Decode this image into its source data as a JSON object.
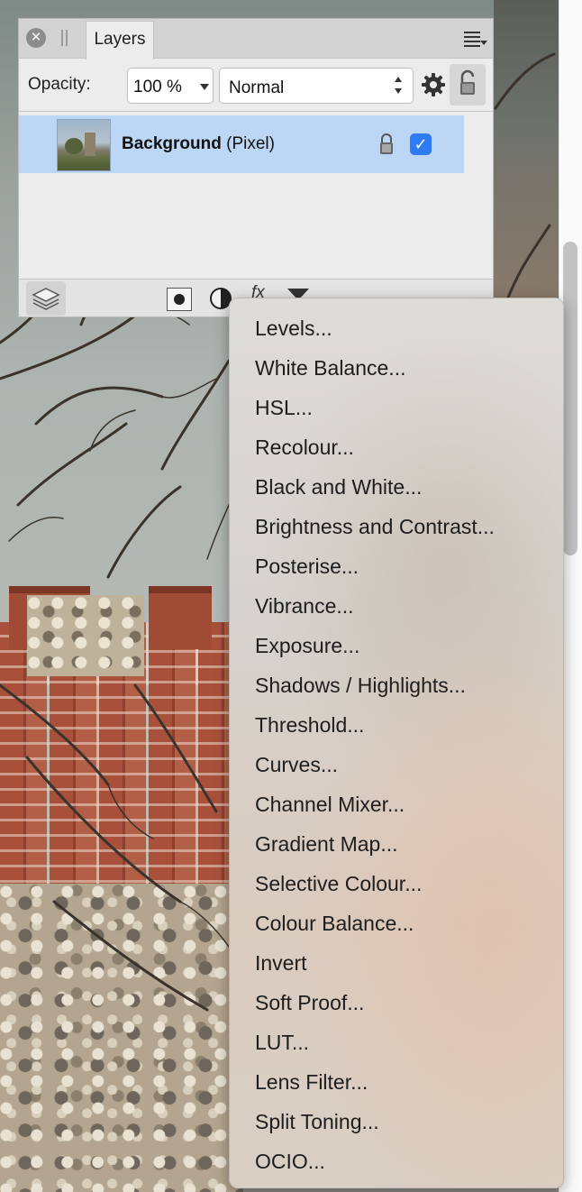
{
  "panel": {
    "tab_label": "Layers",
    "opacity_label": "Opacity:",
    "opacity_value": "100 %",
    "blend_mode": "Normal"
  },
  "layers": [
    {
      "name": "Background",
      "type": "(Pixel)",
      "locked": true,
      "visible": true,
      "selected": true
    }
  ],
  "footer_buttons": [
    "layers-studio-icon",
    "mask-icon",
    "adjustment-icon",
    "fx-icon",
    "live-filter-icon",
    "group-icon",
    "duplicate-icon",
    "delete-icon"
  ],
  "adjustment_menu": {
    "items": [
      "Levels...",
      "White Balance...",
      "HSL...",
      "Recolour...",
      "Black and White...",
      "Brightness and Contrast...",
      "Posterise...",
      "Vibrance...",
      "Exposure...",
      "Shadows / Highlights...",
      "Threshold...",
      "Curves...",
      "Channel Mixer...",
      "Gradient Map...",
      "Selective Colour...",
      "Colour Balance...",
      "Invert",
      "Soft Proof...",
      "LUT...",
      "Lens Filter...",
      "Split Toning...",
      "OCIO..."
    ]
  },
  "colors": {
    "selection": "#bcd6f5",
    "checkbox": "#2f7bf5",
    "panel_bg": "#ececec"
  }
}
